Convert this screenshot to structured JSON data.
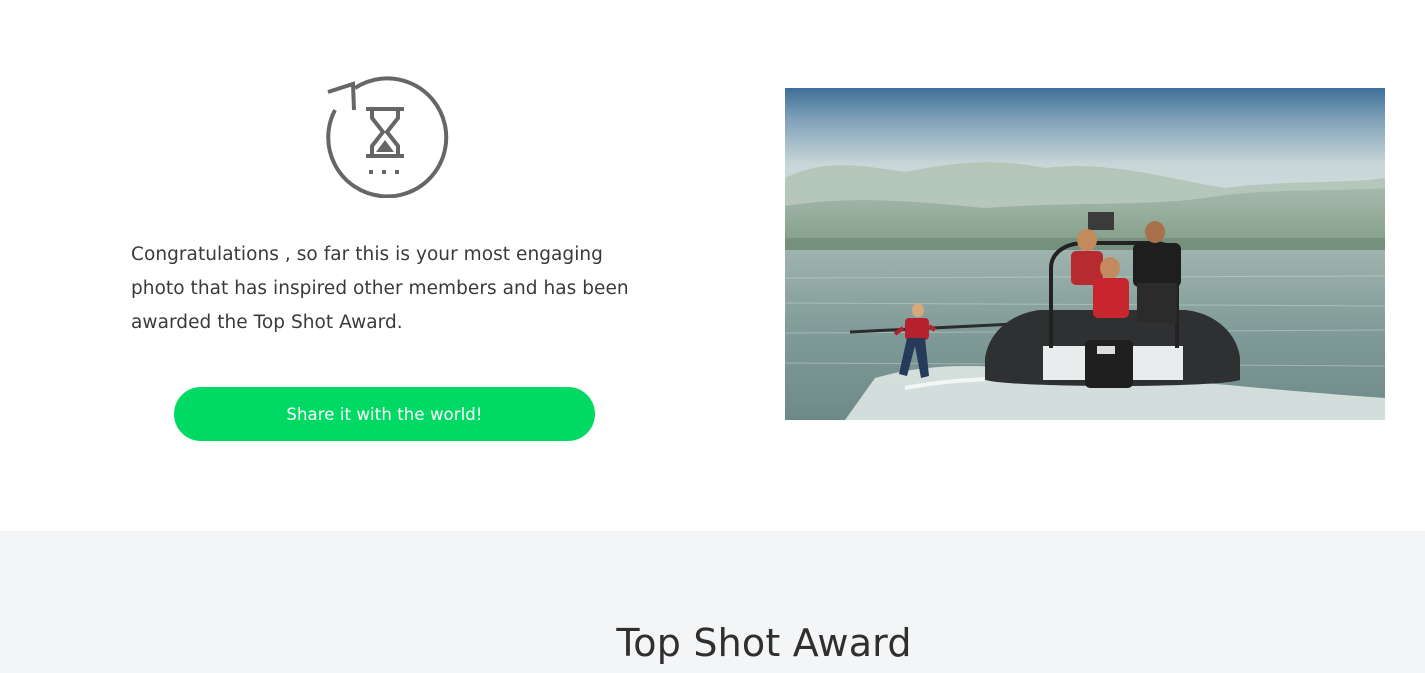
{
  "hero": {
    "icon": "hourglass-refresh-icon",
    "message": "Congratulations , so far this is your most engaging photo that has inspired other members and has been awarded the Top Shot Award.",
    "share_label": "Share it with the world!",
    "photo": "rib-boat-waterski-photo"
  },
  "award_section": {
    "title": "Top Shot Award"
  },
  "colors": {
    "accent": "#00d964",
    "icon": "#666666",
    "text": "#3a3a3a",
    "section_bg": "#f4f5f7"
  }
}
